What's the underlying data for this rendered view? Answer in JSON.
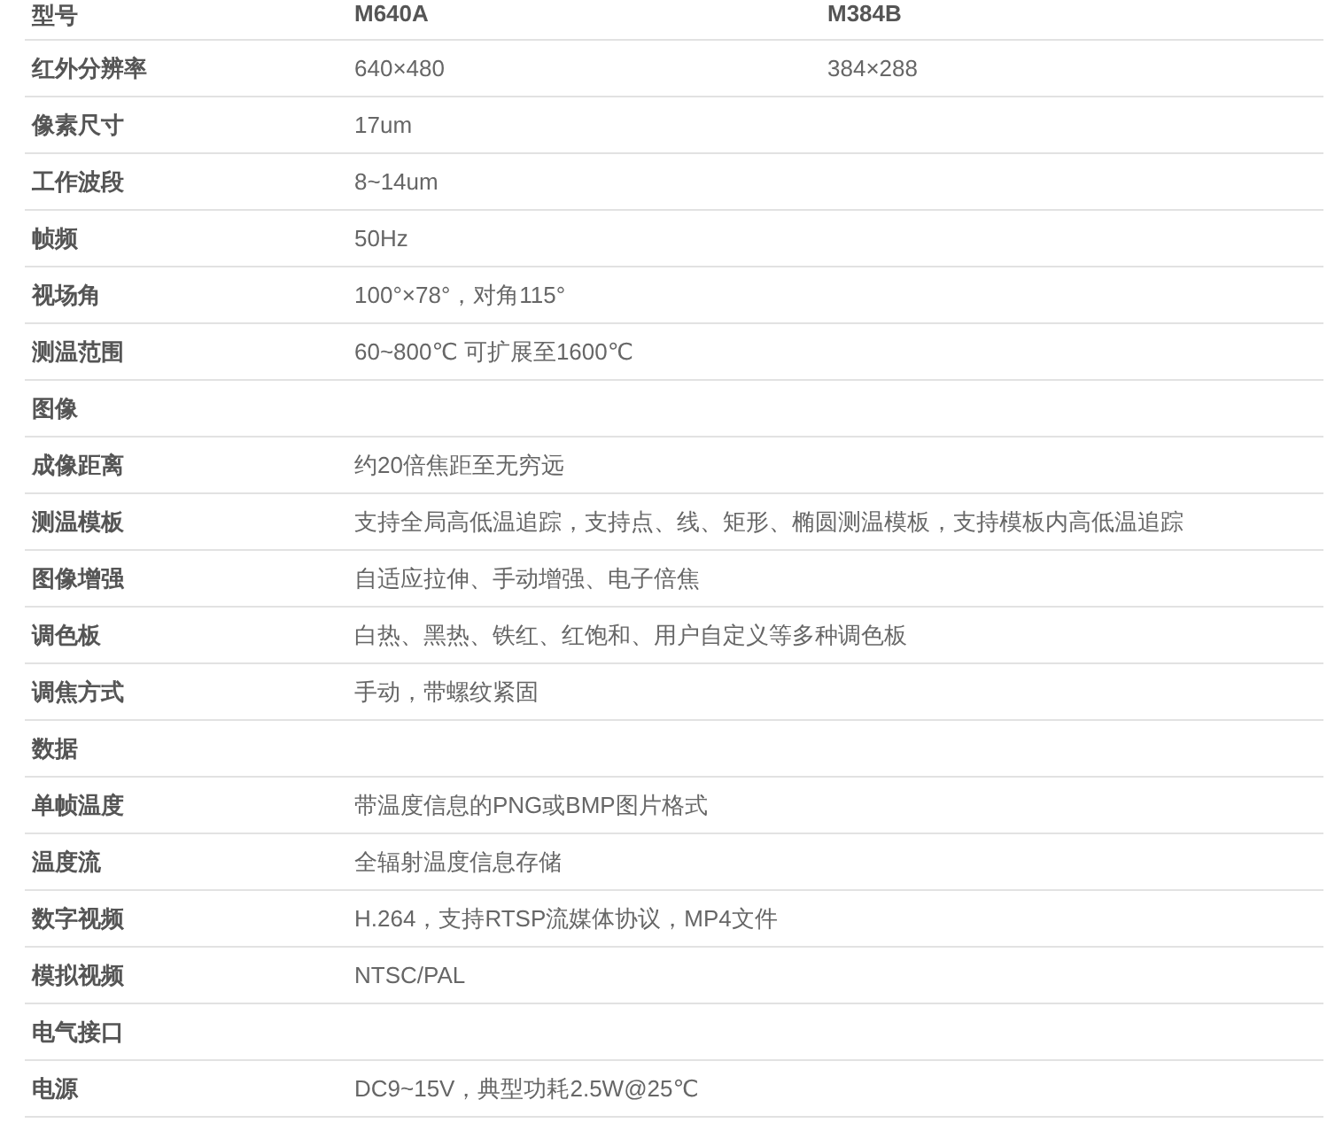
{
  "header": {
    "label": "型号",
    "models": [
      "M640A",
      "M384B"
    ]
  },
  "rows": [
    {
      "kind": "spec",
      "label": "红外分辨率",
      "values": [
        "640×480",
        "384×288"
      ]
    },
    {
      "kind": "spec",
      "label": "像素尺寸",
      "values": [
        "17um"
      ]
    },
    {
      "kind": "spec",
      "label": "工作波段",
      "values": [
        "8~14um"
      ]
    },
    {
      "kind": "spec",
      "label": "帧频",
      "values": [
        "50Hz"
      ]
    },
    {
      "kind": "spec",
      "label": "视场角",
      "values": [
        "100°×78°，对角115°"
      ]
    },
    {
      "kind": "spec",
      "label": "测温范围",
      "values": [
        "60~800℃ 可扩展至1600℃"
      ]
    },
    {
      "kind": "section",
      "label": "图像"
    },
    {
      "kind": "spec",
      "label": "成像距离",
      "values": [
        "约20倍焦距至无穷远"
      ]
    },
    {
      "kind": "spec",
      "label": "测温模板",
      "values": [
        "支持全局高低温追踪，支持点、线、矩形、椭圆测温模板，支持模板内高低温追踪"
      ]
    },
    {
      "kind": "spec",
      "label": "图像增强",
      "values": [
        "自适应拉伸、手动增强、电子倍焦"
      ]
    },
    {
      "kind": "spec",
      "label": "调色板",
      "values": [
        "白热、黑热、铁红、红饱和、用户自定义等多种调色板"
      ]
    },
    {
      "kind": "spec",
      "label": "调焦方式",
      "values": [
        "手动，带螺纹紧固"
      ]
    },
    {
      "kind": "section",
      "label": "数据"
    },
    {
      "kind": "spec",
      "label": "单帧温度",
      "values": [
        "带温度信息的PNG或BMP图片格式"
      ]
    },
    {
      "kind": "spec",
      "label": "温度流",
      "values": [
        "全辐射温度信息存储"
      ]
    },
    {
      "kind": "spec",
      "label": "数字视频",
      "values": [
        "H.264，支持RTSP流媒体协议，MP4文件"
      ]
    },
    {
      "kind": "spec",
      "label": "模拟视频",
      "values": [
        "NTSC/PAL"
      ]
    },
    {
      "kind": "section",
      "label": "电气接口"
    },
    {
      "kind": "spec",
      "label": "电源",
      "values": [
        "DC9~15V，典型功耗2.5W@25℃"
      ]
    }
  ]
}
